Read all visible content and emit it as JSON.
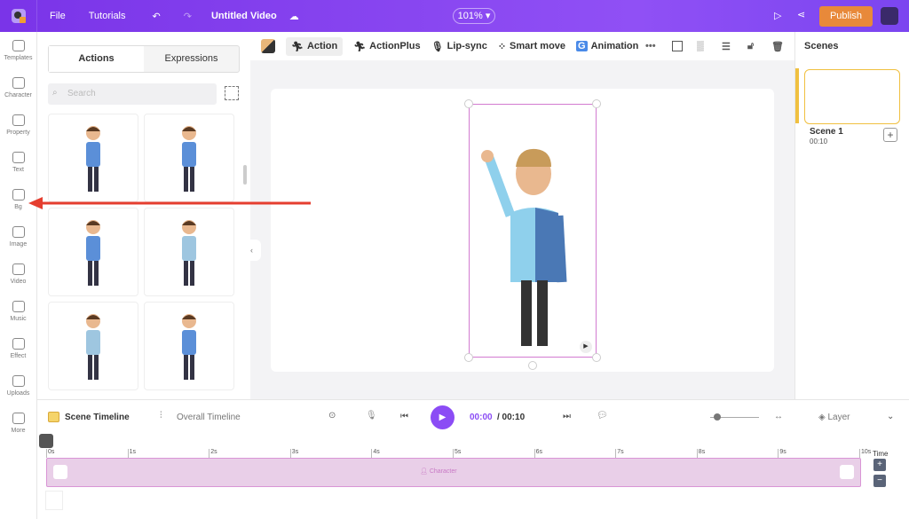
{
  "topbar": {
    "menu": [
      "File",
      "Tutorials"
    ],
    "title": "Untitled Video",
    "zoom": "101%",
    "publish": "Publish"
  },
  "sidebar": [
    {
      "label": "Templates"
    },
    {
      "label": "Character"
    },
    {
      "label": "Property"
    },
    {
      "label": "Text"
    },
    {
      "label": "Bg"
    },
    {
      "label": "Image"
    },
    {
      "label": "Video"
    },
    {
      "label": "Music"
    },
    {
      "label": "Effect"
    },
    {
      "label": "Uploads"
    },
    {
      "label": "More"
    }
  ],
  "panel": {
    "tabs": [
      "Actions",
      "Expressions"
    ],
    "search_placeholder": "Search"
  },
  "toolbar": {
    "items": [
      "Action",
      "ActionPlus",
      "Lip-sync",
      "Smart move",
      "Animation"
    ]
  },
  "scenes": {
    "title": "Scenes",
    "scene_name": "Scene 1",
    "scene_duration": "00:10"
  },
  "timeline": {
    "scene_tab": "Scene Timeline",
    "overall_tab": "Overall Timeline",
    "current": "00:00",
    "total": "/ 00:10",
    "layer": "Layer",
    "ticks": [
      "0s",
      "1s",
      "2s",
      "3s",
      "4s",
      "5s",
      "6s",
      "7s",
      "8s",
      "9s",
      "10s"
    ],
    "track_label": "Character",
    "time_label": "Time"
  },
  "colors": {
    "accent": "#8b4cf5",
    "publish": "#e8893a",
    "track": "#e9cfe8",
    "arrow": "#e53e2f"
  }
}
